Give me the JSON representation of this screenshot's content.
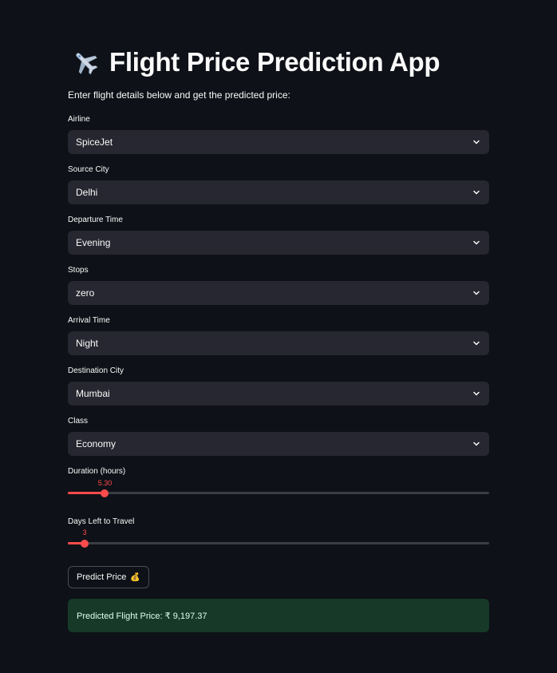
{
  "app": {
    "title": "Flight Price Prediction App",
    "title_icon": "airplane-icon",
    "subtitle": "Enter flight details below and get the predicted price:"
  },
  "fields": {
    "airline": {
      "label": "Airline",
      "value": "SpiceJet"
    },
    "source_city": {
      "label": "Source City",
      "value": "Delhi"
    },
    "departure_time": {
      "label": "Departure Time",
      "value": "Evening"
    },
    "stops": {
      "label": "Stops",
      "value": "zero"
    },
    "arrival_time": {
      "label": "Arrival Time",
      "value": "Night"
    },
    "destination_city": {
      "label": "Destination City",
      "value": "Mumbai"
    },
    "class": {
      "label": "Class",
      "value": "Economy"
    }
  },
  "sliders": {
    "duration": {
      "label": "Duration (hours)",
      "value": "5.30",
      "fraction": 0.088
    },
    "days_left": {
      "label": "Days Left to Travel",
      "value": "3",
      "fraction": 0.04
    }
  },
  "predict_button": {
    "label": "Predict Price",
    "icon": "money-bag-icon"
  },
  "result": {
    "text": "Predicted Flight Price: ₹ 9,197.37"
  },
  "colors": {
    "background": "#0e1117",
    "select_bg": "#262730",
    "accent": "#ff4b4b",
    "success_bg": "#173928"
  }
}
